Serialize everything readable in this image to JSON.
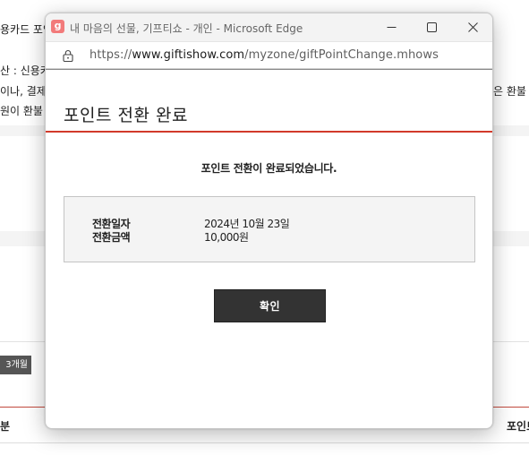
{
  "background": {
    "line1": "용카드 포인",
    "line2": "산 : 신용카",
    "line3": "이나, 결제",
    "line3_right": "은 환불 대",
    "line4": "원이 환불 대",
    "chip_label": "3개월",
    "table_header_left": "분",
    "table_header_right": "포인트"
  },
  "window": {
    "app_icon_letter": "g",
    "title": "내 마음의 선물, 기프티쇼 - 개인 - Microsoft Edge",
    "url_prefix": "https://",
    "url_host": "www.giftishow.com",
    "url_path": "/myzone/giftPointChange.mhows"
  },
  "popup": {
    "title": "포인트 전환 완료",
    "message": "포인트 전환이 완료되었습니다.",
    "rows": [
      {
        "label": "전환일자",
        "value": "2024년 10월 23일"
      },
      {
        "label": "전환금액",
        "value": "10,000원"
      }
    ],
    "confirm_label": "확인"
  },
  "colors": {
    "accent_rule": "#d23a2a",
    "button_bg": "#333333",
    "app_icon": "#f27a7a"
  }
}
